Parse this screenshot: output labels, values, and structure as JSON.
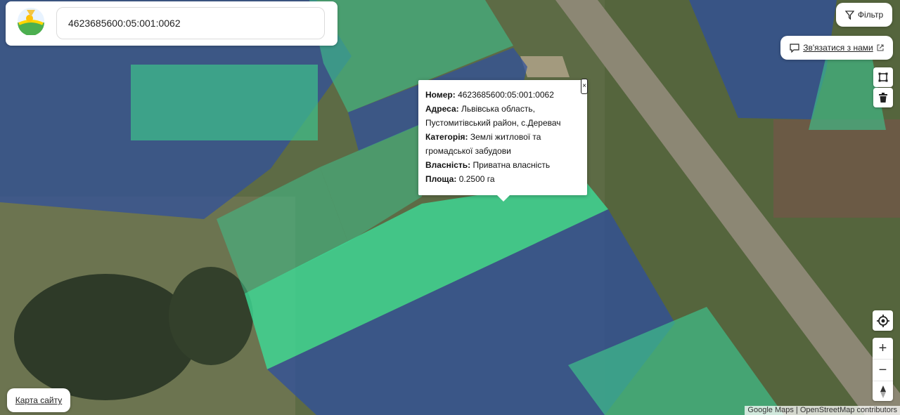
{
  "search": {
    "value": "4623685600:05:001:0062"
  },
  "filter": {
    "label": "Фільтр",
    "icon": "funnel-icon"
  },
  "contact": {
    "label": "Зв'язатися з нами",
    "icon": "chat-icon",
    "external_icon": "external-link-icon"
  },
  "tools": [
    {
      "name": "draw-polygon-icon"
    },
    {
      "name": "trash-icon"
    }
  ],
  "controls": {
    "locate_icon": "crosshair-icon",
    "zoom_in": "+",
    "zoom_out": "−",
    "compass_icon": "compass-icon"
  },
  "sitemap": {
    "label": "Карта сайту"
  },
  "attribution": "Google Maps | OpenStreetMap contributors",
  "popup": {
    "close": "×",
    "fields": [
      {
        "label": "Номер:",
        "value": "4623685600:05:001:0062"
      },
      {
        "label": "Адреса:",
        "value": "Львівська область, Пустомитівський район, с.Деревач"
      },
      {
        "label": "Категорія:",
        "value": "Землі житлової та громадської забудови"
      },
      {
        "label": "Власність:",
        "value": "Приватна власність"
      },
      {
        "label": "Площа:",
        "value": "0.2500 га"
      }
    ]
  },
  "colors": {
    "parcel_blue": "#2f4f9e",
    "parcel_green": "#3fbf8a",
    "selected_green": "#3ddc97"
  }
}
